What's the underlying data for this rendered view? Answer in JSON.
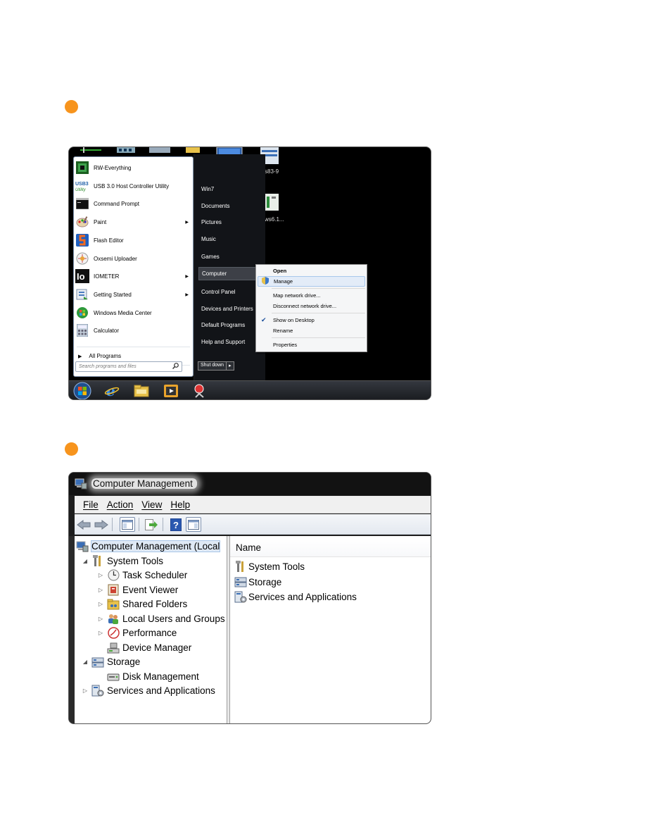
{
  "colors": {
    "step_dot": "#f7941d",
    "selection": "#dfe9f5",
    "menu_black": "#121418"
  },
  "start_menu": {
    "programs": [
      {
        "label": "RW-Everything",
        "icon": "rw-everything-icon",
        "has_submenu": false
      },
      {
        "label": "USB 3.0 Host Controller Utility",
        "icon": "usb3-icon",
        "has_submenu": false
      },
      {
        "label": "Command Prompt",
        "icon": "command-prompt-icon",
        "has_submenu": false
      },
      {
        "label": "Paint",
        "icon": "paint-icon",
        "has_submenu": true
      },
      {
        "label": "Flash Editor",
        "icon": "flash-editor-icon",
        "has_submenu": false
      },
      {
        "label": "Oxsemi Uploader",
        "icon": "oxsemi-icon",
        "has_submenu": false
      },
      {
        "label": "IOMETER",
        "icon": "iometer-icon",
        "has_submenu": true
      },
      {
        "label": "Getting Started",
        "icon": "getting-started-icon",
        "has_submenu": true
      },
      {
        "label": "Windows Media Center",
        "icon": "media-center-icon",
        "has_submenu": false
      },
      {
        "label": "Calculator",
        "icon": "calculator-icon",
        "has_submenu": false
      }
    ],
    "all_programs": "All Programs",
    "search_placeholder": "Search programs and files",
    "right_items": [
      "Win7",
      "Documents",
      "Pictures",
      "Music",
      "Games",
      "Computer",
      "Control Panel",
      "Devices and Printers",
      "Default Programs",
      "Help and Support"
    ],
    "selected_right_item": "Computer",
    "shutdown_label": "Shut down",
    "desktop_labels": [
      "s83-9",
      "ws6.1..."
    ]
  },
  "context_menu": {
    "items": [
      {
        "label": "Open",
        "bold": true
      },
      {
        "label": "Manage",
        "selected": true,
        "icon": "shield-icon"
      },
      {
        "label": "Map network drive..."
      },
      {
        "label": "Disconnect network drive..."
      },
      {
        "label": "Show on Desktop",
        "checked": true
      },
      {
        "label": "Rename"
      },
      {
        "label": "Properties"
      }
    ]
  },
  "computer_management": {
    "title": "Computer Management",
    "menu": [
      "File",
      "Action",
      "View",
      "Help"
    ],
    "tree": {
      "root": "Computer Management (Local",
      "system_tools": "System Tools",
      "system_children": [
        "Task Scheduler",
        "Event Viewer",
        "Shared Folders",
        "Local Users and Groups",
        "Performance",
        "Device Manager"
      ],
      "storage": "Storage",
      "storage_children": [
        "Disk Management"
      ],
      "services": "Services and Applications"
    },
    "list_header": "Name",
    "list_items": [
      "System Tools",
      "Storage",
      "Services and Applications"
    ]
  }
}
